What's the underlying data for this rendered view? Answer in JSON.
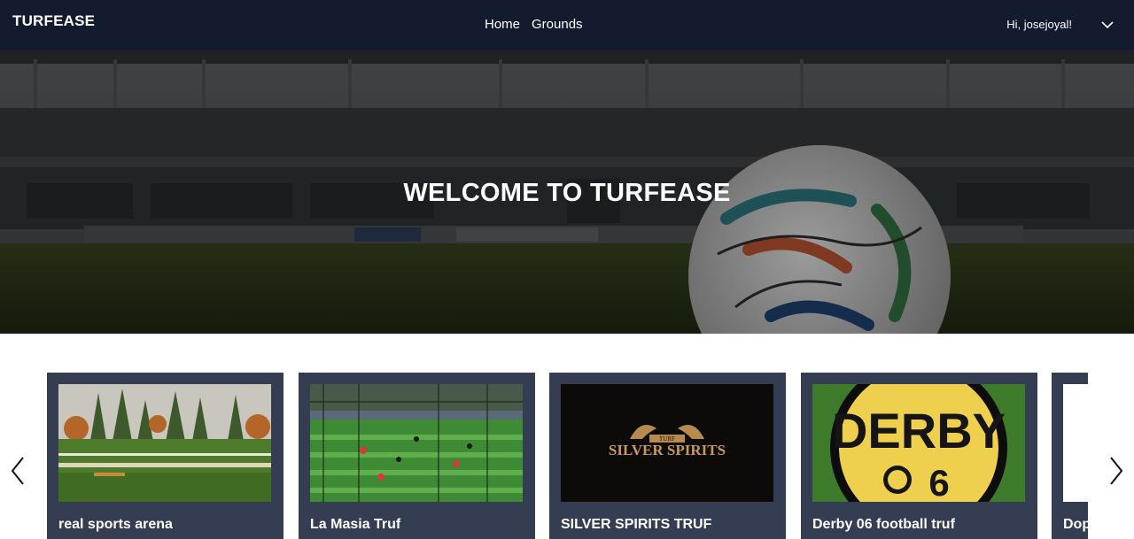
{
  "navbar": {
    "brand": "TURFEASE",
    "links": [
      "Home",
      "Grounds"
    ],
    "greeting": "Hi, josejoyal!"
  },
  "hero": {
    "title": "WELCOME TO TURFEASE"
  },
  "grounds": [
    {
      "name": "real sports arena"
    },
    {
      "name": "La Masia Truf"
    },
    {
      "name": "SILVER SPIRITS TRUF",
      "logo_text_top": "TURF",
      "logo_text": "SILVER SPIRITS"
    },
    {
      "name": "Derby 06 football truf",
      "logo_text_top": "DERBY",
      "logo_text_bottom": "6"
    },
    {
      "name": "Dop"
    }
  ],
  "colors": {
    "navbar": "#141b2e",
    "card": "#343d51"
  }
}
